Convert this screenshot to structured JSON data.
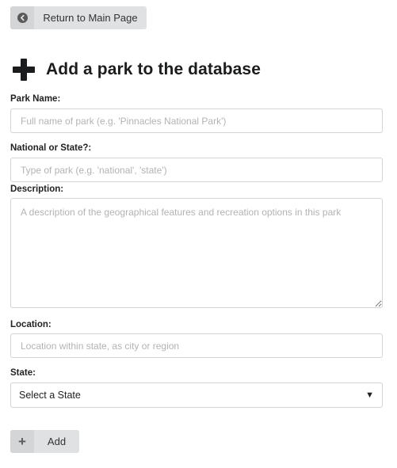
{
  "nav": {
    "return_label": "Return to Main Page",
    "return_icon": "arrow-left-circle-icon"
  },
  "page": {
    "title": "Add a park to the database",
    "title_icon": "plus-icon"
  },
  "form": {
    "park_name": {
      "label": "Park Name:",
      "placeholder": "Full name of park (e.g. 'Pinnacles National Park')"
    },
    "park_type": {
      "label": "National or State?:",
      "placeholder": "Type of park (e.g. 'national', 'state')"
    },
    "description": {
      "label": "Description:",
      "placeholder": "A description of the geographical features and recreation options in this park"
    },
    "location": {
      "label": "Location:",
      "placeholder": "Location within state, as city or region"
    },
    "state": {
      "label": "State:",
      "selected": "Select a State",
      "caret": "▼"
    },
    "submit": {
      "label": "Add",
      "icon": "plus-icon"
    }
  }
}
